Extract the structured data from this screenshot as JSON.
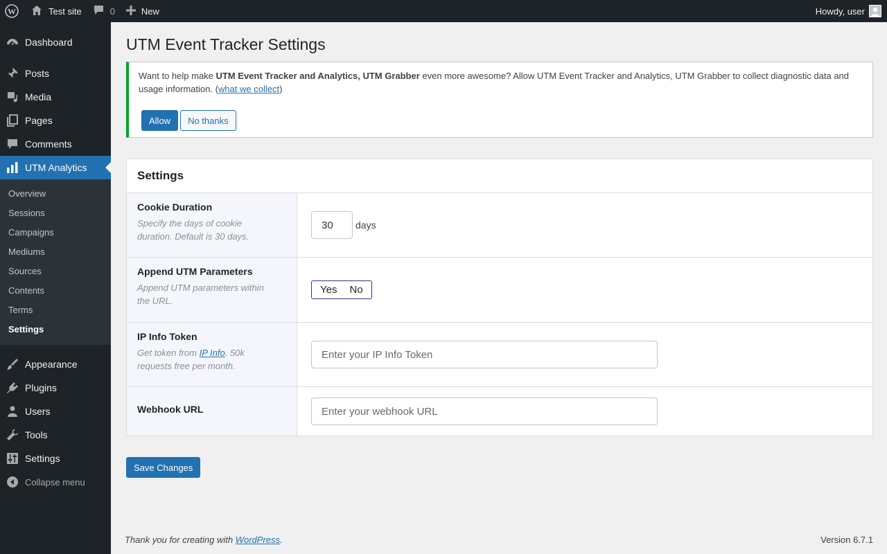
{
  "admin_bar": {
    "site_name": "Test site",
    "comments_count": "0",
    "new_label": "New",
    "greeting": "Howdy, user"
  },
  "sidebar": {
    "items_top": [
      {
        "label": "Dashboard",
        "icon": "dashboard-icon"
      },
      {
        "label": "Posts",
        "icon": "pin-icon"
      },
      {
        "label": "Media",
        "icon": "media-icon"
      },
      {
        "label": "Pages",
        "icon": "pages-icon"
      },
      {
        "label": "Comments",
        "icon": "comments-icon"
      },
      {
        "label": "UTM Analytics",
        "icon": "bar-chart-icon"
      }
    ],
    "submenu": [
      "Overview",
      "Sessions",
      "Campaigns",
      "Mediums",
      "Sources",
      "Contents",
      "Terms",
      "Settings"
    ],
    "items_bottom": [
      {
        "label": "Appearance",
        "icon": "brush-icon"
      },
      {
        "label": "Plugins",
        "icon": "plugin-icon"
      },
      {
        "label": "Users",
        "icon": "user-icon"
      },
      {
        "label": "Tools",
        "icon": "wrench-icon"
      },
      {
        "label": "Settings",
        "icon": "sliders-icon"
      }
    ],
    "collapse_label": "Collapse menu"
  },
  "page": {
    "title": "UTM Event Tracker Settings"
  },
  "notice": {
    "text_pre": "Want to help make ",
    "plugin_name": "UTM Event Tracker and Analytics, UTM Grabber",
    "text_mid": " even more awesome? Allow UTM Event Tracker and Analytics, UTM Grabber to collect diagnostic data and usage information. (",
    "link": "what we collect",
    "text_post": ")",
    "allow_label": "Allow",
    "decline_label": "No thanks"
  },
  "settings": {
    "heading": "Settings",
    "cookie": {
      "label": "Cookie Duration",
      "desc": "Specify the days of cookie duration. Default is 30 days.",
      "value": "30",
      "unit": "days"
    },
    "append": {
      "label": "Append UTM Parameters",
      "desc": "Append UTM parameters within the URL.",
      "yes": "Yes",
      "no": "No"
    },
    "ipinfo": {
      "label": "IP Info Token",
      "desc_pre": "Get token from ",
      "desc_link": "IP Info",
      "desc_post": ". 50k requests free per month.",
      "placeholder": "Enter your IP Info Token"
    },
    "webhook": {
      "label": "Webhook URL",
      "placeholder": "Enter your webhook URL"
    },
    "save_label": "Save Changes"
  },
  "footer": {
    "thanks_pre": "Thank you for creating with ",
    "thanks_link": "WordPress",
    "thanks_post": ".",
    "version": "Version 6.7.1"
  }
}
